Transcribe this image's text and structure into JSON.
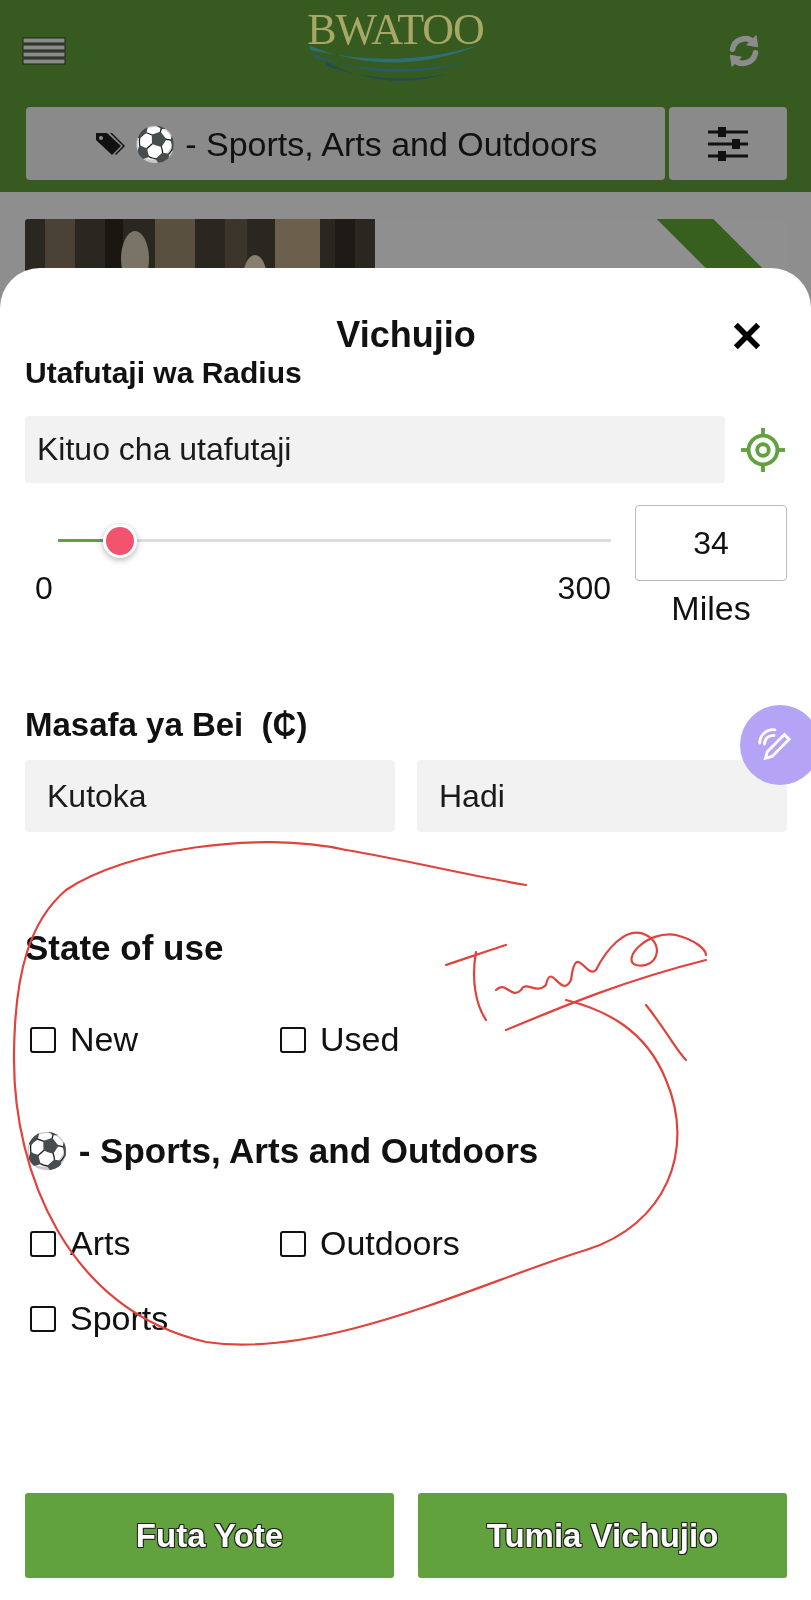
{
  "header": {
    "logo": "BWATOO"
  },
  "category_bar": {
    "label": "⚽ - Sports, Arts and Outdoors"
  },
  "filters_sheet": {
    "title": "Vichujio",
    "radius": {
      "heading": "Utafutaji wa Radius",
      "placeholder": "Kituo cha utafutaji",
      "min": "0",
      "max": "300",
      "value": "34",
      "unit": "Miles",
      "level": 0.113
    },
    "price": {
      "heading": "Masafa ya Bei  (₵)",
      "from_placeholder": "Kutoka",
      "to_placeholder": "Hadi"
    },
    "sections": [
      {
        "heading": "State of use",
        "options": [
          {
            "label": "New",
            "checked": false
          },
          {
            "label": "Used",
            "checked": false
          }
        ]
      },
      {
        "heading": "⚽ - Sports, Arts and Outdoors",
        "options": [
          {
            "label": "Arts",
            "checked": false
          },
          {
            "label": "Outdoors",
            "checked": false
          },
          {
            "label": "Sports",
            "checked": false
          }
        ]
      }
    ],
    "buttons": [
      {
        "label": "Futa Yote"
      },
      {
        "label": "Tumia Vichujio"
      }
    ]
  }
}
